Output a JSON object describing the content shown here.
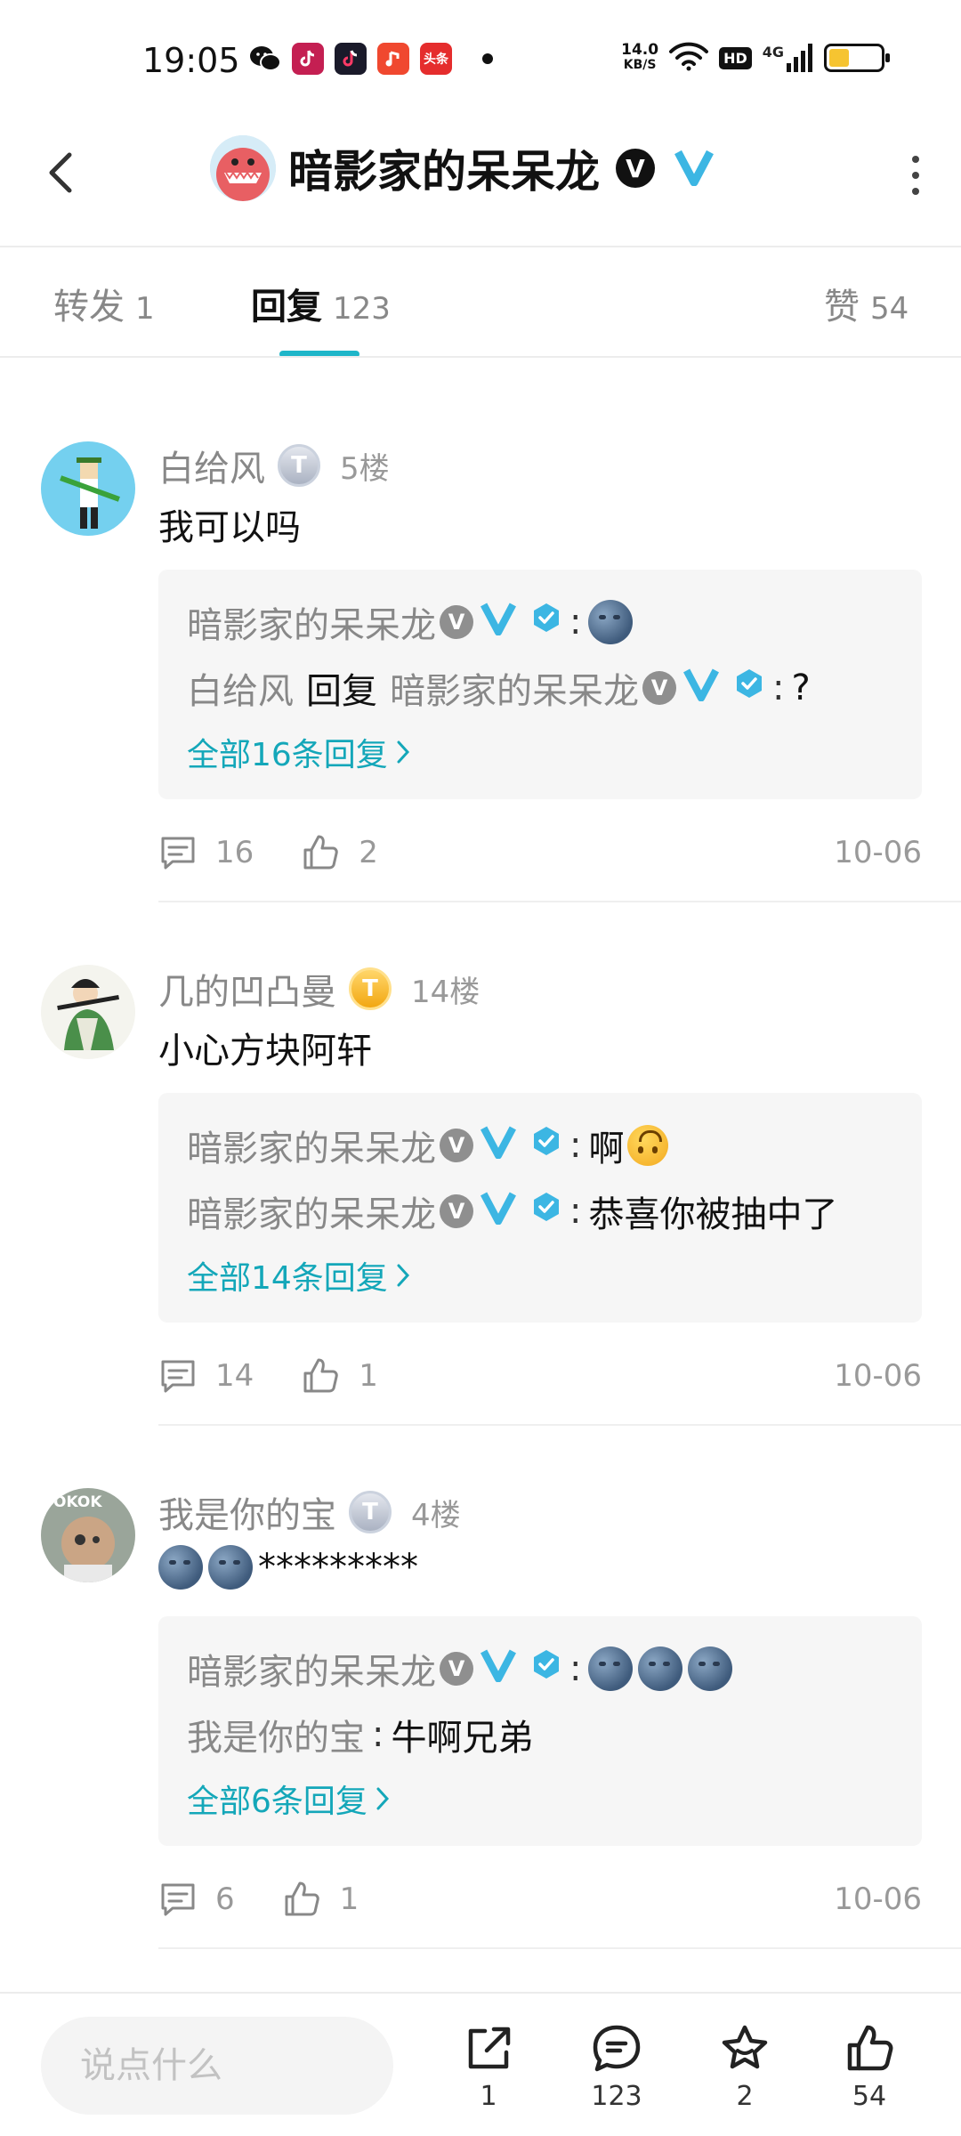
{
  "status_bar": {
    "time": "19:05",
    "net_speed_value": "14.0",
    "net_speed_unit": "KB/S",
    "hd_label": "HD",
    "network": "4G",
    "apps": [
      "wechat-icon",
      "tiktok-lite-icon",
      "tiktok-icon",
      "music-icon",
      "toutiao-icon"
    ],
    "toutiao_label": "头条",
    "battery_level": 0.4
  },
  "header": {
    "title": "暗影家的呆呆龙",
    "v_mark": "V"
  },
  "tabs": [
    {
      "label": "转发",
      "count": "1"
    },
    {
      "label": "回复",
      "count": "123"
    },
    {
      "label": "赞",
      "count": "54"
    }
  ],
  "comments": [
    {
      "user": "白给风",
      "badge": "T",
      "floor": "5楼",
      "text": "我可以吗",
      "replies": [
        {
          "author": "暗影家的呆呆龙",
          "content_type": "moon"
        },
        {
          "author": "白给风",
          "reply_word": "回复",
          "target": "暗影家的呆呆龙",
          "content": "?"
        }
      ],
      "more": "全部16条回复",
      "comments_count": "16",
      "likes": "2",
      "date": "10-06"
    },
    {
      "user": "几的凹凸曼",
      "badge": "T",
      "floor": "14楼",
      "text": "小心方块阿轩",
      "replies": [
        {
          "author": "暗影家的呆呆龙",
          "content": "啊"
        },
        {
          "author": "暗影家的呆呆龙",
          "content": "恭喜你被抽中了"
        }
      ],
      "more": "全部14条回复",
      "comments_count": "14",
      "likes": "1",
      "date": "10-06"
    },
    {
      "user": "我是你的宝",
      "badge": "T",
      "floor": "4楼",
      "text": "*********",
      "replies": [
        {
          "author": "暗影家的呆呆龙",
          "content_type": "three-moons"
        },
        {
          "author": "我是你的宝",
          "content": "牛啊兄弟"
        }
      ],
      "more": "全部6条回复",
      "comments_count": "6",
      "likes": "1",
      "date": "10-06"
    }
  ],
  "avatar_text": "OKOK",
  "bottom_bar": {
    "placeholder": "说点什么",
    "share_count": "1",
    "comment_count": "123",
    "favorite_count": "2",
    "like_count": "54"
  },
  "colors": {
    "accent": "#1eb6c9",
    "link": "#14a7b9",
    "verified_v": "#3cb6e3",
    "gold_badge": "#f2a712"
  }
}
